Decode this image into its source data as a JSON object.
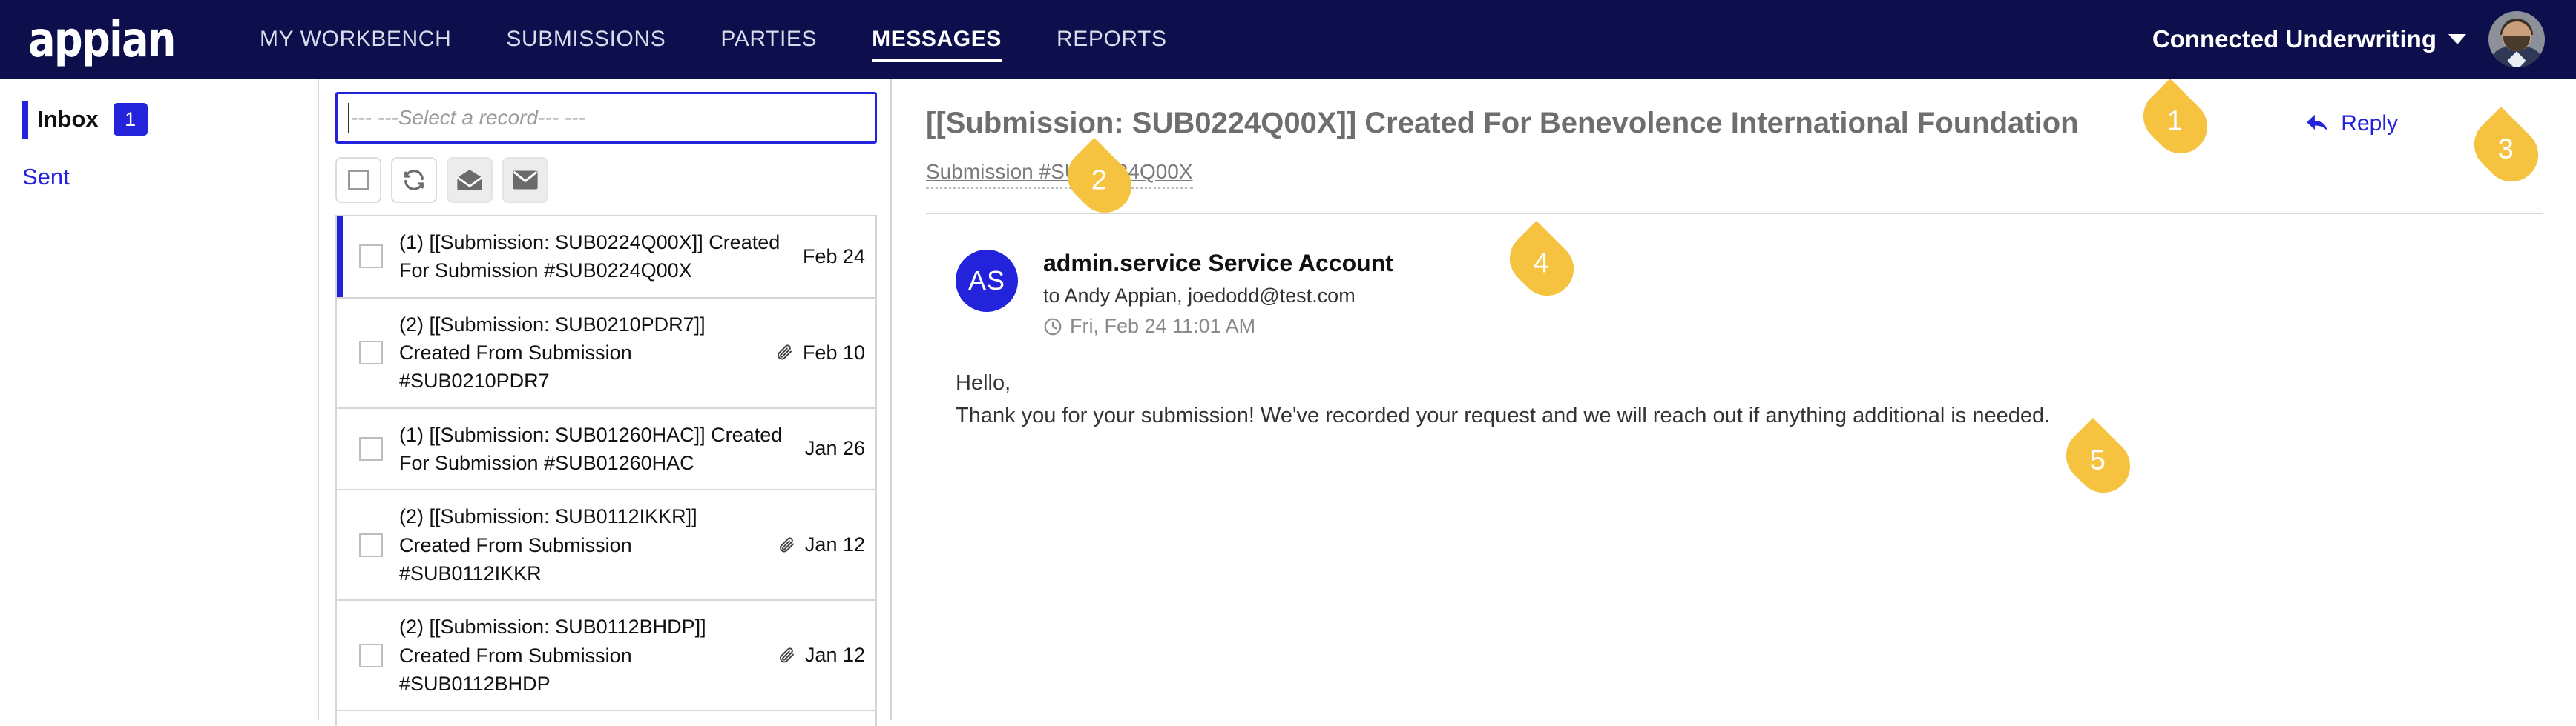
{
  "brand": {
    "logo_text": "appian",
    "navy": "#0c0f4b",
    "accent_blue": "#2323dc",
    "callout_yellow": "#f5c340"
  },
  "topnav": {
    "items": [
      {
        "label": "MY WORKBENCH",
        "active": false
      },
      {
        "label": "SUBMISSIONS",
        "active": false
      },
      {
        "label": "PARTIES",
        "active": false
      },
      {
        "label": "MESSAGES",
        "active": true
      },
      {
        "label": "REPORTS",
        "active": false
      }
    ],
    "org_name": "Connected Underwriting"
  },
  "sidebar": {
    "items": [
      {
        "label": "Inbox",
        "badge": "1",
        "active": true
      },
      {
        "label": "Sent",
        "badge": "",
        "active": false
      }
    ]
  },
  "listpane": {
    "record_select_placeholder": "--- ---Select a record--- ---",
    "toolbar": [
      {
        "name": "select-all-checkbox"
      },
      {
        "name": "refresh-icon"
      },
      {
        "name": "mark-read-icon"
      },
      {
        "name": "mark-unread-icon"
      }
    ],
    "messages": [
      {
        "subject": "(1) [[Submission: SUB0224Q00X]] Created For Submission #SUB0224Q00X",
        "date": "Feb 24",
        "attachment": false,
        "selected": true
      },
      {
        "subject": "(2) [[Submission: SUB0210PDR7]] Created From Submission #SUB0210PDR7",
        "date": "Feb 10",
        "attachment": true,
        "selected": false
      },
      {
        "subject": "(1) [[Submission: SUB01260HAC]] Created For Submission #SUB01260HAC",
        "date": "Jan 26",
        "attachment": false,
        "selected": false
      },
      {
        "subject": "(2) [[Submission: SUB0112IKKR]] Created From Submission #SUB0112IKKR",
        "date": "Jan 12",
        "attachment": true,
        "selected": false
      },
      {
        "subject": "(2) [[Submission: SUB0112BHDP]] Created From Submission #SUB0112BHDP",
        "date": "Jan 12",
        "attachment": true,
        "selected": false
      }
    ]
  },
  "reader": {
    "title": "[[Submission: SUB0224Q00X]] Created For Benevolence International Foundation",
    "breadcrumb": "Submission #SUB0224Q00X",
    "reply_label": "Reply",
    "sender": {
      "initials": "AS",
      "name": "admin.service Service Account",
      "recipients": "to Andy Appian, joedodd@test.com",
      "timestamp": "Fri, Feb 24 11:01 AM"
    },
    "body_line1": "Hello,",
    "body_line2": "Thank you for your submission! We've recorded your request and we will reach out if anything additional is needed."
  },
  "callouts": [
    {
      "number": "1"
    },
    {
      "number": "2"
    },
    {
      "number": "3"
    },
    {
      "number": "4"
    },
    {
      "number": "5"
    }
  ]
}
